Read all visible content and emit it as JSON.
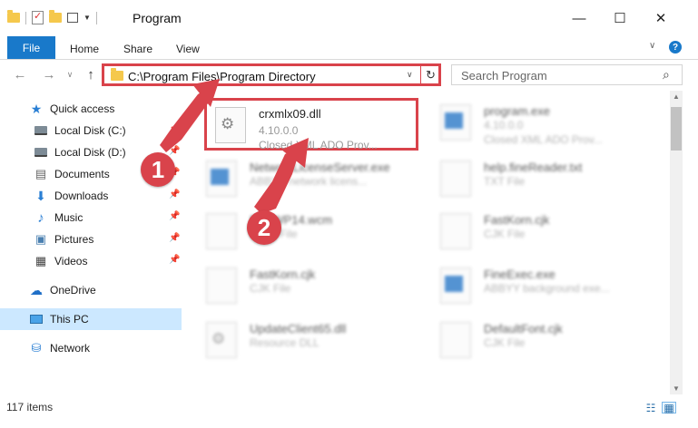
{
  "window": {
    "title": "Program",
    "minimize": "—",
    "maximize": "☐",
    "close": "✕"
  },
  "ribbon": {
    "file": "File",
    "tabs": [
      "Home",
      "Share",
      "View"
    ],
    "help": "?",
    "caret": "∨"
  },
  "nav": {
    "back": "←",
    "forward": "→",
    "recent": "∨",
    "up": "↑"
  },
  "address": {
    "path": "C:\\Program Files\\Program Directory",
    "caret": "∨",
    "refresh": "↻"
  },
  "search": {
    "placeholder": "Search Program",
    "icon": "⌕"
  },
  "sidebar": {
    "items": [
      {
        "label": "Quick access",
        "icon": "star-icon"
      },
      {
        "label": "Local Disk (C:)",
        "icon": "disk-icon"
      },
      {
        "label": "Local Disk (D:)",
        "icon": "disk-icon"
      },
      {
        "label": "Documents",
        "icon": "documents-icon"
      },
      {
        "label": "Downloads",
        "icon": "downloads-icon"
      },
      {
        "label": "Music",
        "icon": "music-icon"
      },
      {
        "label": "Pictures",
        "icon": "pictures-icon"
      },
      {
        "label": "Videos",
        "icon": "videos-icon"
      },
      {
        "label": "OneDrive",
        "icon": "cloud-icon"
      },
      {
        "label": "This PC",
        "icon": "pc-icon"
      },
      {
        "label": "Network",
        "icon": "network-icon"
      }
    ],
    "pin": "📌"
  },
  "files": [
    {
      "name": "crxmlx09.dll",
      "line2": "4.10.0.0",
      "line3": "Closed XML ADO Prov..."
    },
    {
      "name": "program.exe",
      "line2": "4.10.0.0",
      "line3": "Closed XML ADO Prov..."
    },
    {
      "name": "NetworkLicenseServer.exe",
      "line2": "ABBYY network licens..."
    },
    {
      "name": "help.fineReader.txt",
      "line2": "TXT File"
    },
    {
      "name": "FineWP14.wcm",
      "line2": "WCM File"
    },
    {
      "name": "FastKorn.cjk",
      "line2": "CJK File"
    },
    {
      "name": "FastKorn.cjk",
      "line2": "CJK File"
    },
    {
      "name": "FineExec.exe",
      "line2": "ABBYY background exe..."
    },
    {
      "name": "UpdateClient65.dll",
      "line2": "Resource DLL"
    },
    {
      "name": "DefaultFont.cjk",
      "line2": "CJK File"
    }
  ],
  "status": {
    "count": "117 items"
  },
  "annotations": {
    "step1": "1",
    "step2": "2"
  },
  "colors": {
    "accent": "#1979ca",
    "highlight": "#d9434b",
    "selected_nav": "#cce8ff"
  }
}
